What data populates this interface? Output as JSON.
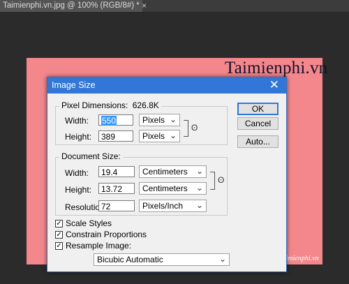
{
  "document_tab": {
    "title": "Taimienphi.vn.jpg @ 100% (RGB/8#) *",
    "close": "×"
  },
  "canvas": {
    "watermark": "Taimienphi.vn",
    "watermark_bottom": "Taimienphi.vn"
  },
  "dialog": {
    "title": "Image Size",
    "close": "✕",
    "pixel_dimensions": {
      "label": "Pixel Dimensions:",
      "size": "626.8K",
      "width_label": "Width:",
      "width_value": "550",
      "width_unit": "Pixels",
      "height_label": "Height:",
      "height_value": "389",
      "height_unit": "Pixels"
    },
    "document_size": {
      "label": "Document Size:",
      "width_label": "Width:",
      "width_value": "19.4",
      "width_unit": "Centimeters",
      "height_label": "Height:",
      "height_value": "13.72",
      "height_unit": "Centimeters",
      "resolution_label": "Resolution:",
      "resolution_value": "72",
      "resolution_unit": "Pixels/Inch"
    },
    "options": {
      "scale_styles": "Scale Styles",
      "constrain_proportions": "Constrain Proportions",
      "resample_image": "Resample Image:",
      "resample_method": "Bicubic Automatic"
    },
    "buttons": {
      "ok": "OK",
      "cancel": "Cancel",
      "auto": "Auto..."
    },
    "icons": {
      "chevron": "⌄",
      "chain": "ʘ",
      "check": "✓"
    }
  }
}
